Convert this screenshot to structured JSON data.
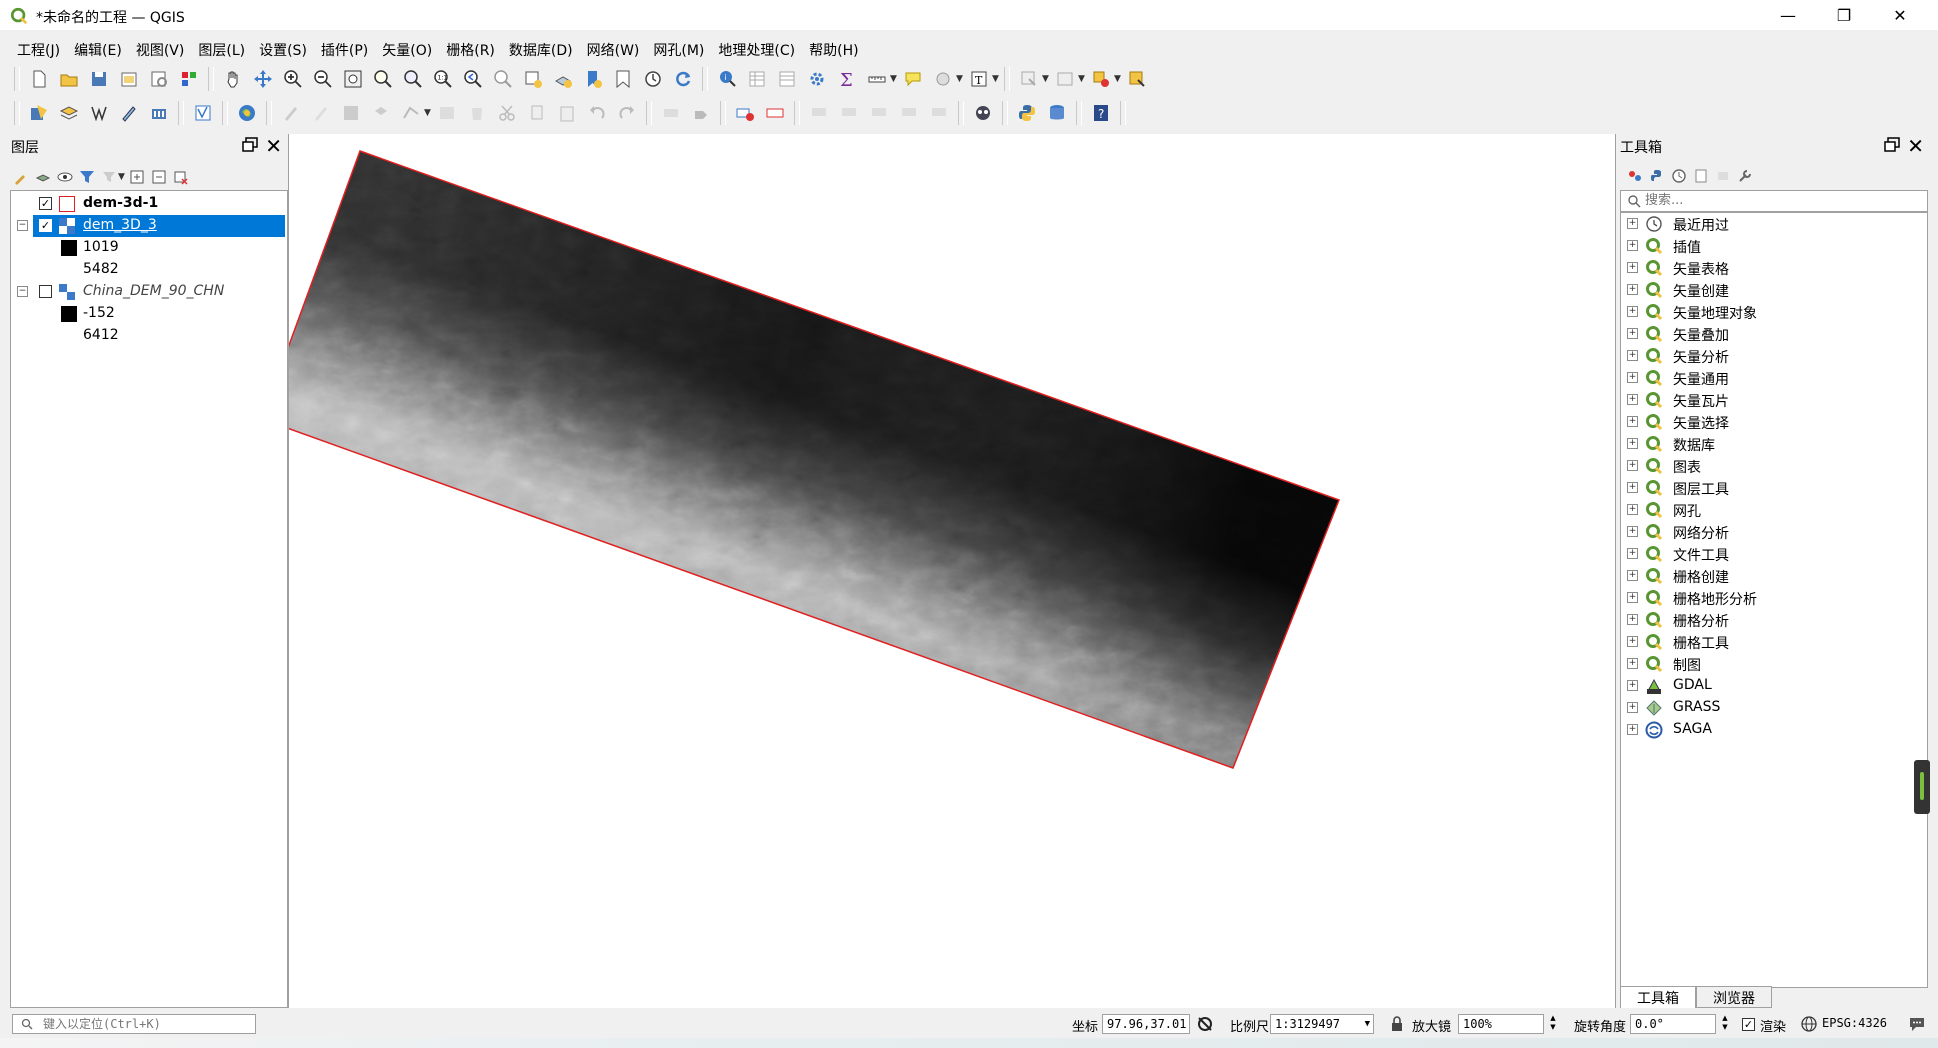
{
  "window": {
    "title": "*未命名的工程 — QGIS",
    "minimize": "—",
    "restore": "❐",
    "close": "✕"
  },
  "menu": [
    "工程(J)",
    "编辑(E)",
    "视图(V)",
    "图层(L)",
    "设置(S)",
    "插件(P)",
    "矢量(O)",
    "栅格(R)",
    "数据库(D)",
    "网络(W)",
    "网孔(M)",
    "地理处理(C)",
    "帮助(H)"
  ],
  "layers_panel": {
    "title": "图层",
    "layers": [
      {
        "name": "dem-3d-1",
        "checked": true,
        "bold": true
      },
      {
        "name": "dem_3D_3",
        "checked": true,
        "selected": true
      },
      {
        "legend_low": "1019",
        "legend_high": "5482"
      },
      {
        "name": "China_DEM_90_CHN",
        "checked": false,
        "italic": true
      },
      {
        "legend_low": "-152",
        "legend_high": "6412"
      }
    ]
  },
  "toolbox": {
    "title": "工具箱",
    "search_placeholder": "搜索...",
    "items": [
      "最近用过",
      "插值",
      "矢量表格",
      "矢量创建",
      "矢量地理对象",
      "矢量叠加",
      "矢量分析",
      "矢量通用",
      "矢量瓦片",
      "矢量选择",
      "数据库",
      "图表",
      "图层工具",
      "网孔",
      "网络分析",
      "文件工具",
      "栅格创建",
      "栅格地形分析",
      "栅格分析",
      "栅格工具",
      "制图",
      "GDAL",
      "GRASS",
      "SAGA"
    ],
    "tabs": [
      "工具箱",
      "浏览器"
    ]
  },
  "statusbar": {
    "locator_placeholder": "键入以定位(Ctrl+K)",
    "coord_label": "坐标",
    "coord_value": "97.96,37.01",
    "scale_label": "比例尺",
    "scale_value": "1:3129497",
    "magnifier_label": "放大镜",
    "magnifier_value": "100%",
    "rotation_label": "旋转角度",
    "rotation_value": "0.0°",
    "render_label": "渲染",
    "crs_label": "EPSG:4326"
  },
  "colors": {
    "selection": "#0078d7",
    "extent_outline": "#e02020",
    "qgis_green": "#589632"
  }
}
